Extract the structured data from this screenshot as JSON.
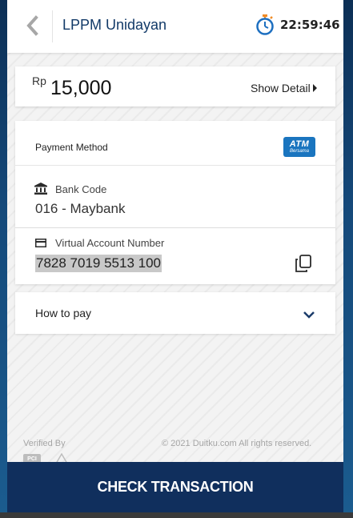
{
  "header": {
    "back_icon": "chevron-left-icon",
    "title": "LPPM Unidayan",
    "timer_icon": "stopwatch-icon",
    "timer": "22:59:46"
  },
  "amount": {
    "currency": "Rp",
    "value": "15,000",
    "show_detail_label": "Show Detail"
  },
  "payment": {
    "method_label": "Payment Method",
    "method_logo_main": "ATM",
    "method_logo_sub": "Bersama",
    "bank_code_label": "Bank Code",
    "bank_code_value": "016 - Maybank",
    "va_label": "Virtual Account Number",
    "va_value": "7828 7019 5513 100",
    "copy_icon": "copy-icon"
  },
  "how_to_pay": {
    "label": "How to pay",
    "icon": "chevron-down-icon"
  },
  "footer": {
    "verified_label": "Verified By",
    "copyright": "© 2021 Duitku.com All rights reserved."
  },
  "actions": {
    "check_transaction": "CHECK TRANSACTION"
  },
  "colors": {
    "brand_navy": "#102f5d",
    "title_blue": "#123a68",
    "atm_blue": "#1a75bf",
    "timer_orange": "#f08a24"
  }
}
